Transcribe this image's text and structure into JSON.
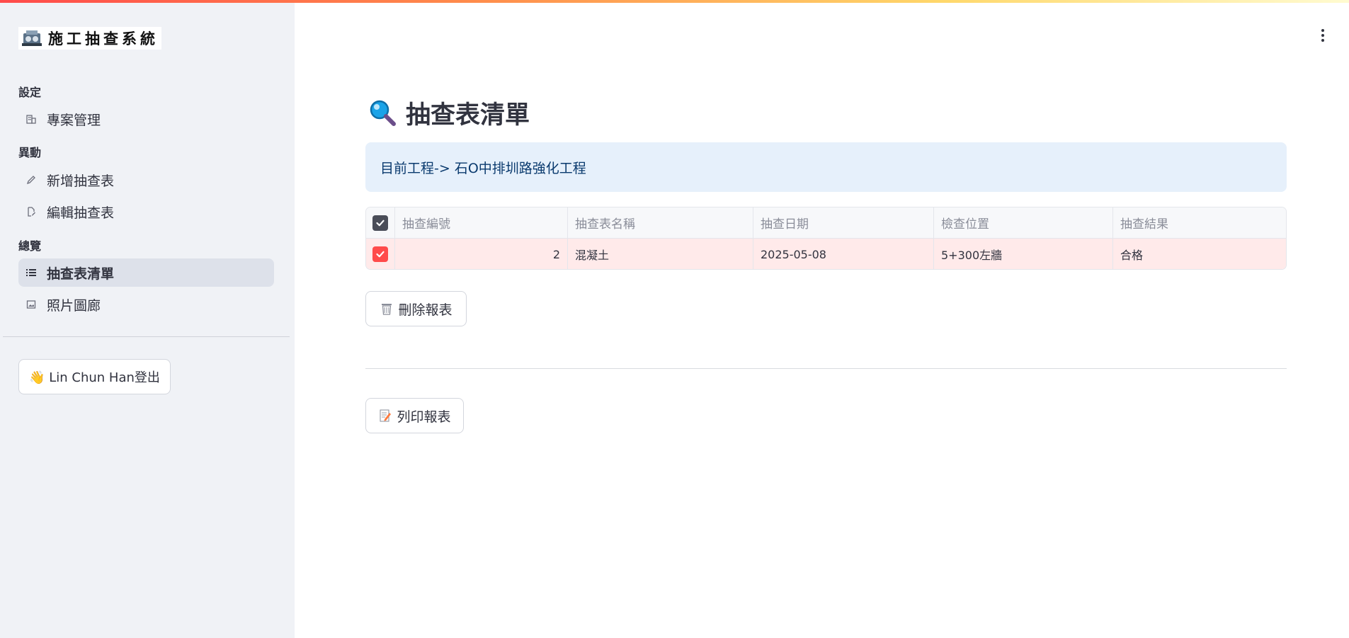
{
  "sidebar": {
    "logo_text": "施工抽查系統",
    "sections": [
      {
        "label": "設定"
      },
      {
        "label": "異動"
      },
      {
        "label": "總覽"
      }
    ],
    "items": [
      {
        "label": "專案管理",
        "icon": "building-icon"
      },
      {
        "label": "新增抽查表",
        "icon": "pencil-icon"
      },
      {
        "label": "編輯抽查表",
        "icon": "edit-document-icon"
      },
      {
        "label": "抽查表清單",
        "icon": "list-icon",
        "active": true
      },
      {
        "label": "照片圖廊",
        "icon": "image-icon"
      }
    ],
    "logout_label": "👋 Lin Chun Han登出"
  },
  "main": {
    "title": "抽查表清單",
    "title_icon": "magnifier-icon",
    "info": "目前工程-> 石O中排圳路強化工程",
    "table": {
      "columns": [
        "抽查編號",
        "抽查表名稱",
        "抽查日期",
        "檢查位置",
        "抽查結果"
      ],
      "rows": [
        {
          "selected": true,
          "cells": [
            "2",
            "混凝土",
            "2025-05-08",
            "5+300左牆",
            "合格"
          ]
        }
      ]
    },
    "delete_label": "刪除報表",
    "print_label": "列印報表"
  },
  "colors": {
    "accent": "#ff4b4b",
    "sidebar_bg": "#f0f2f6",
    "info_bg": "#e6f0fb",
    "info_text": "#0a3a6e",
    "selected_row": "#ffeaea"
  }
}
